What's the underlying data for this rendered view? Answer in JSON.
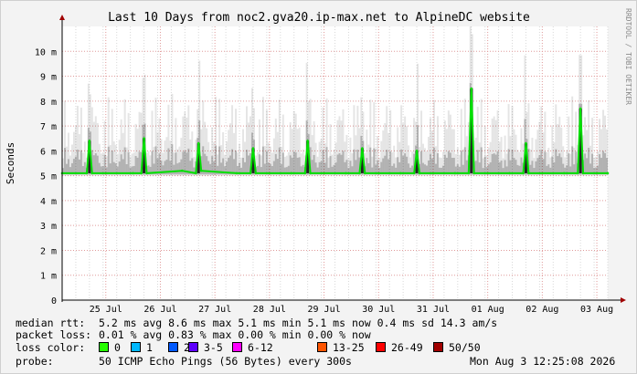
{
  "chart_data": {
    "type": "line",
    "title": "Last 10 Days from noc2.gva20.ip-max.net to AlpineDC website",
    "ylabel": "Seconds",
    "side_label": "RRDTOOL / TOBI OETIKER",
    "ylim": [
      0,
      0.011
    ],
    "y_ticks": [
      0,
      0.001,
      0.002,
      0.003,
      0.004,
      0.005,
      0.006,
      0.007,
      0.008,
      0.009,
      0.01
    ],
    "y_tick_labels": [
      "0",
      "1 m",
      "2 m",
      "3 m",
      "4 m",
      "5 m",
      "6 m",
      "7 m",
      "8 m",
      "9 m",
      "10 m"
    ],
    "x_range_days": [
      0,
      10.0
    ],
    "x_tick_days": [
      0.8,
      1.8,
      2.8,
      3.8,
      4.8,
      5.8,
      6.8,
      7.8,
      8.8,
      9.8
    ],
    "x_tick_labels": [
      "25 Jul",
      "26 Jul",
      "27 Jul",
      "28 Jul",
      "29 Jul",
      "30 Jul",
      "31 Jul",
      "01 Aug",
      "02 Aug",
      "03 Aug"
    ],
    "series": [
      {
        "name": "median rtt",
        "x_days": [
          0.0,
          0.45,
          0.5,
          0.55,
          1.3,
          1.45,
          1.5,
          1.55,
          2.2,
          2.45,
          2.5,
          2.55,
          3.2,
          3.45,
          3.5,
          3.55,
          4.2,
          4.45,
          4.5,
          4.55,
          5.2,
          5.45,
          5.5,
          5.55,
          6.2,
          6.45,
          6.5,
          6.55,
          7.2,
          7.45,
          7.5,
          7.55,
          8.2,
          8.45,
          8.5,
          8.55,
          9.2,
          9.45,
          9.5,
          9.55,
          10.0
        ],
        "y": [
          0.0051,
          0.0051,
          0.0064,
          0.0051,
          0.0051,
          0.0051,
          0.0065,
          0.0051,
          0.0052,
          0.0051,
          0.0063,
          0.0052,
          0.0051,
          0.0051,
          0.0061,
          0.0051,
          0.0051,
          0.0051,
          0.0064,
          0.0051,
          0.0051,
          0.0051,
          0.0061,
          0.0051,
          0.0051,
          0.0051,
          0.006,
          0.0051,
          0.0051,
          0.0051,
          0.0085,
          0.0051,
          0.0051,
          0.0051,
          0.0063,
          0.0051,
          0.0051,
          0.0051,
          0.0077,
          0.0051,
          0.0051
        ]
      }
    ],
    "grid": true
  },
  "stats": [
    {
      "label": "median rtt:",
      "text": "5.2 ms avg   8.6 ms max   5.1 ms min   5.1 ms now   0.4 ms sd  14.3    am/s"
    },
    {
      "label": "packet loss:",
      "text": "0.01 % avg   0.83 % max   0.00 % min   0.00 % now"
    }
  ],
  "loss_color": {
    "label": "loss color:",
    "items": [
      {
        "label": "0",
        "color": "#26ff00"
      },
      {
        "label": "1",
        "color": "#00b8ff"
      },
      {
        "label": "2",
        "color": "#0059ff"
      },
      {
        "label": "3-5",
        "color": "#5e00ff"
      },
      {
        "label": "6-12",
        "color": "#ff00ff"
      },
      {
        "label": "13-25",
        "color": "#ff5500"
      },
      {
        "label": "26-49",
        "color": "#ff0000"
      },
      {
        "label": "50/50",
        "color": "#a10000"
      }
    ]
  },
  "probe": {
    "label": "probe:",
    "text": "50 ICMP Echo Pings (56 Bytes) every 300s",
    "timestamp": "Mon Aug  3 12:25:08 2026"
  },
  "colors": {
    "background": "#f3f3f3",
    "plot": "#ffffff",
    "grid_major": "#e09a9a",
    "grid_minor": "#d8d8d8",
    "median": "#00e000",
    "smoke": "#000000"
  }
}
